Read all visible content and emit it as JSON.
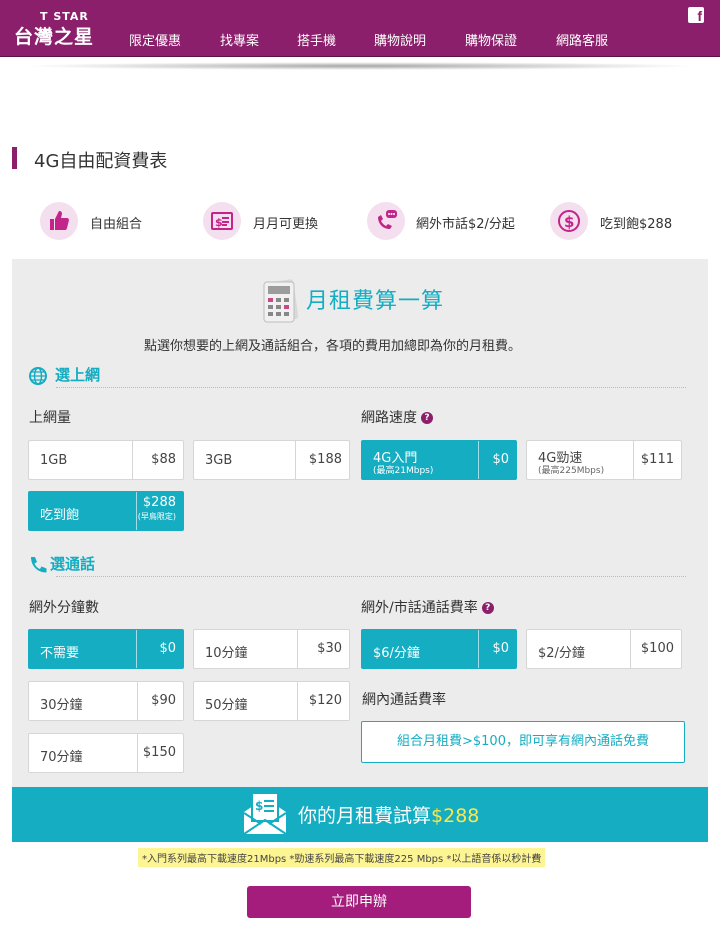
{
  "header": {
    "logo_en": "T STAR",
    "logo_zh": "台灣之星",
    "nav": [
      "限定優惠",
      "找專案",
      "搭手機",
      "購物說明",
      "購物保證",
      "網路客服"
    ]
  },
  "page_title": "4G自由配資費表",
  "features": [
    {
      "icon": "thumbs-up-icon",
      "label": "自由組合"
    },
    {
      "icon": "bill-icon",
      "label": "月月可更換"
    },
    {
      "icon": "phone-chat-icon",
      "label": "網外市話$2/分起"
    },
    {
      "icon": "dollar-icon",
      "label": "吃到飽$288"
    }
  ],
  "calculator": {
    "title": "月租費算一算",
    "description": "點選你想要的上網及通話組合，各項的費用加總即為你的月租費。",
    "data_section": {
      "title": "選上網",
      "volume_label": "上網量",
      "volume_options": [
        {
          "name": "1GB",
          "price": "$88",
          "selected": false
        },
        {
          "name": "3GB",
          "price": "$188",
          "selected": false
        },
        {
          "name": "吃到飽",
          "price": "$288",
          "note": "(早鳥限定)",
          "selected": true
        }
      ],
      "speed_label": "網路速度",
      "speed_options": [
        {
          "name": "4G入門",
          "sub": "(最高21Mbps)",
          "price": "$0",
          "selected": true
        },
        {
          "name": "4G勁速",
          "sub": "(最高225Mbps)",
          "price": "$111",
          "selected": false
        }
      ]
    },
    "call_section": {
      "title": "選通話",
      "minutes_label": "網外分鐘數",
      "minutes_options": [
        {
          "name": "不需要",
          "price": "$0",
          "selected": true
        },
        {
          "name": "10分鐘",
          "price": "$30",
          "selected": false
        },
        {
          "name": "30分鐘",
          "price": "$90",
          "selected": false
        },
        {
          "name": "50分鐘",
          "price": "$120",
          "selected": false
        },
        {
          "name": "70分鐘",
          "price": "$150",
          "selected": false
        }
      ],
      "rate_label": "網外/市話通話費率",
      "rate_options": [
        {
          "name": "$6/分鐘",
          "price": "$0",
          "selected": true
        },
        {
          "name": "$2/分鐘",
          "price": "$100",
          "selected": false
        }
      ],
      "onnet_label": "網內通話費率",
      "onnet_info": "組合月租費>$100，即可享有網內通話免費"
    },
    "total_label": "你的月租費試算",
    "total_price": "$288",
    "footnote": "*入門系列最高下載速度21Mbps *勁速系列最高下載速度225 Mbps *以上語音係以秒計費",
    "apply_label": "立即申辦"
  },
  "colors": {
    "brand": "#8b1f6b",
    "accent": "#14adc2",
    "apply": "#a41d7c",
    "highlight": "#ffe74a"
  }
}
